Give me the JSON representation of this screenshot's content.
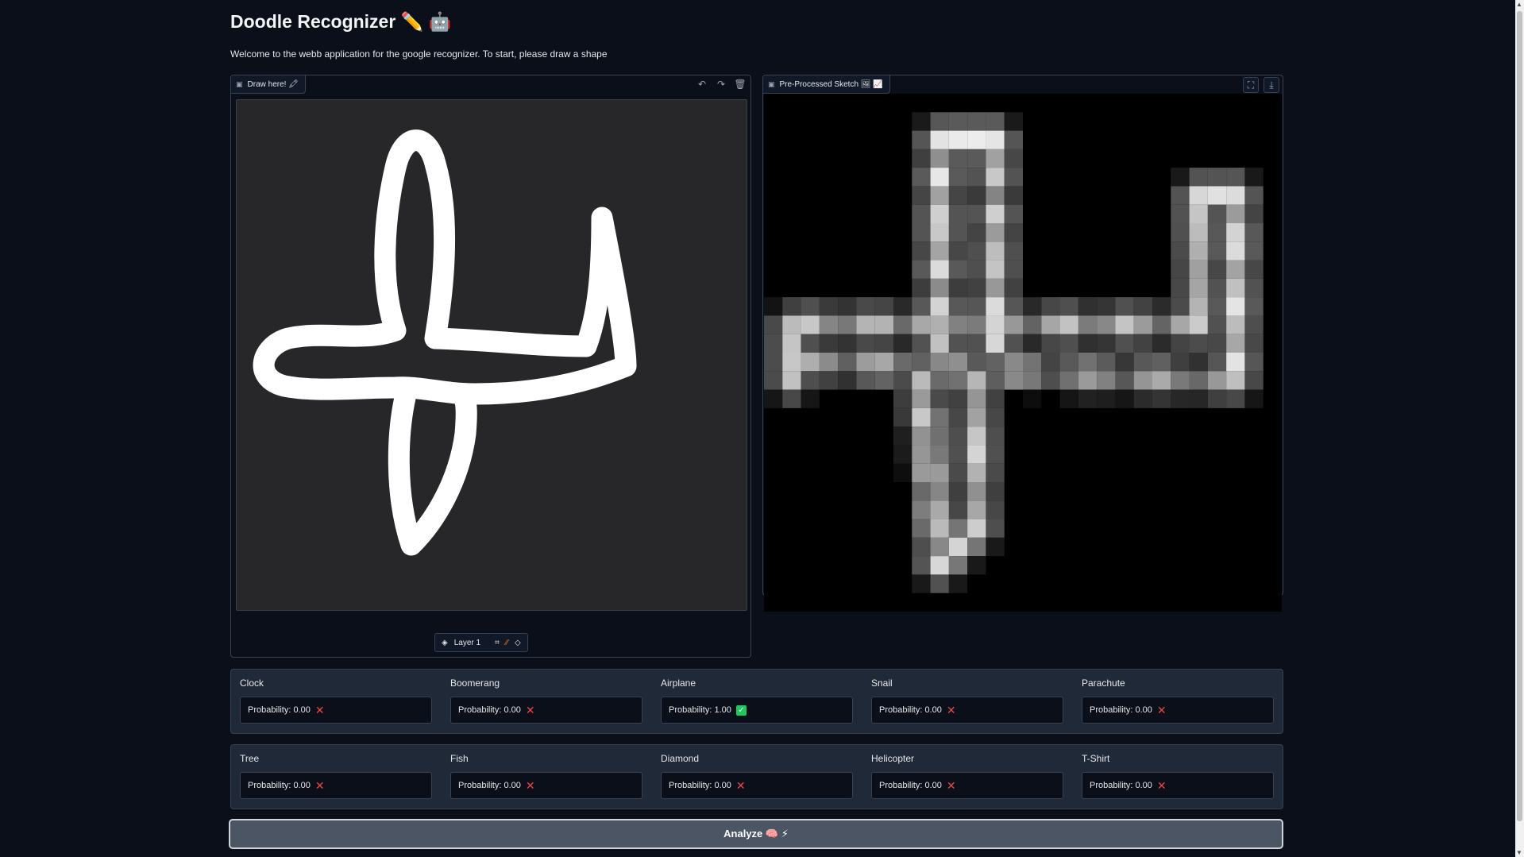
{
  "app": {
    "title": "Doodle Recognizer ✏️ 🤖",
    "subtitle": "Welcome to the webb application for the google recognizer. To start, please draw a shape"
  },
  "draw_panel": {
    "label": "Draw here! 🖍",
    "toolbar_icons": [
      "undo-icon",
      "redo-icon",
      "trash-icon"
    ],
    "layer_label": "Layer 1",
    "bottom_tools": [
      "crop-icon",
      "brush-icon",
      "eraser-icon"
    ]
  },
  "preview_panel": {
    "label": "Pre-Processed Sketch 🖼 📈",
    "toolbar_icons": [
      "fullscreen-icon",
      "download-icon"
    ]
  },
  "predictions_row1": [
    {
      "label": "Clock",
      "value": "Probability: 0.00",
      "match": false
    },
    {
      "label": "Boomerang",
      "value": "Probability: 0.00",
      "match": false
    },
    {
      "label": "Airplane",
      "value": "Probability: 1.00",
      "match": true
    },
    {
      "label": "Snail",
      "value": "Probability: 0.00",
      "match": false
    },
    {
      "label": "Parachute",
      "value": "Probability: 0.00",
      "match": false
    }
  ],
  "predictions_row2": [
    {
      "label": "Tree",
      "value": "Probability: 0.00",
      "match": false
    },
    {
      "label": "Fish",
      "value": "Probability: 0.00",
      "match": false
    },
    {
      "label": "Diamond",
      "value": "Probability: 0.00",
      "match": false
    },
    {
      "label": "Helicopter",
      "value": "Probability: 0.00",
      "match": false
    },
    {
      "label": "T-Shirt",
      "value": "Probability: 0.00",
      "match": false
    }
  ],
  "analyze_button": "Analyze 🧠 ⚡",
  "colors": {
    "background": "#0b0f19",
    "panel_border": "#374151",
    "canvas_bg": "#27272a",
    "stroke": "#ffffff",
    "no_match": "#ef4444",
    "match": "#22c55e",
    "button_bg": "#4b5563"
  }
}
